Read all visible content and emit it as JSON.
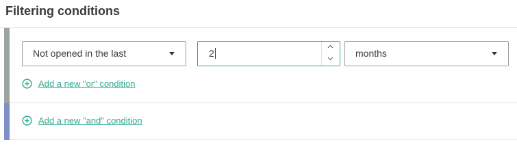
{
  "header": {
    "title": "Filtering conditions"
  },
  "colors": {
    "or_accent": "#9aa5a0",
    "and_accent": "#7f8fc8",
    "link": "#2ea88f"
  },
  "or_group": {
    "condition_select": {
      "value": "Not opened in the last"
    },
    "amount_input": {
      "value": "2"
    },
    "unit_select": {
      "value": "months"
    },
    "add_or_link": "Add a new \"or\" condition"
  },
  "and_group": {
    "add_and_link": "Add a new \"and\" condition"
  },
  "icons": {
    "dropdown": "chevron-down-icon",
    "spin_up": "chevron-up-icon",
    "spin_down": "chevron-down-icon",
    "add": "plus-circle-icon"
  }
}
